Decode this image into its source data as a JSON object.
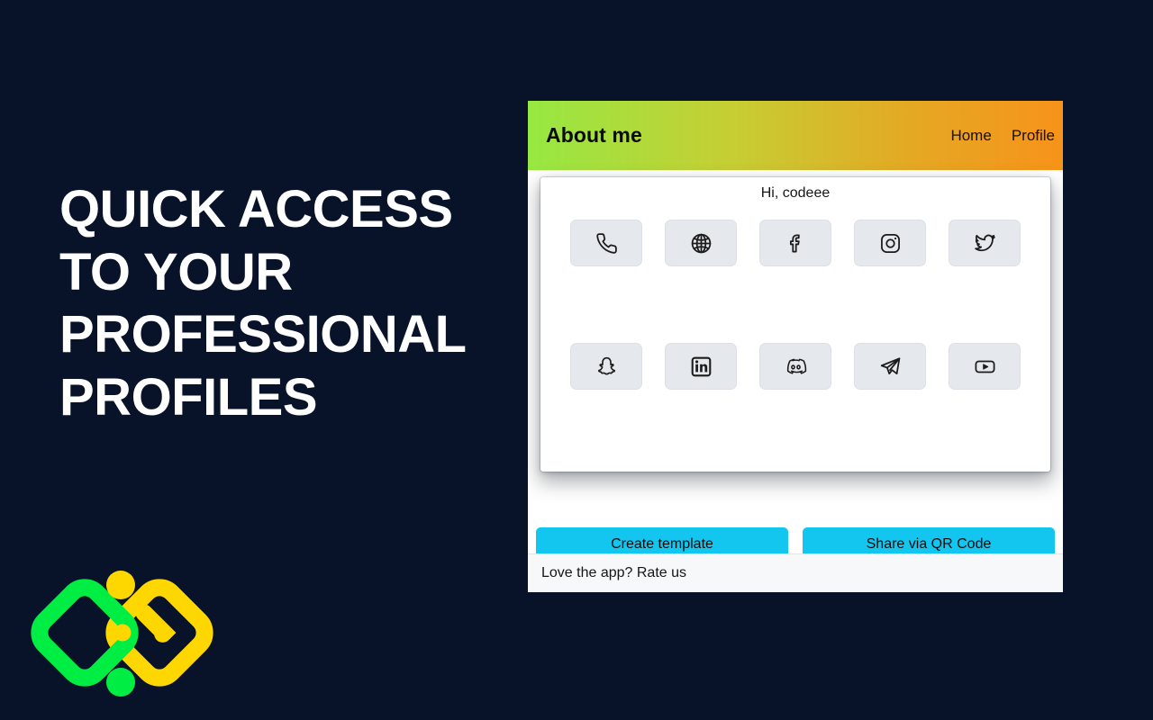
{
  "page": {
    "background_color": "#081228",
    "headline": "QUICK ACCESS TO YOUR PROFESSIONAL PROFILES"
  },
  "logo": {
    "name": "interlocking-diamonds-logo",
    "green_color": "#00EE44",
    "yellow_color": "#FFD700"
  },
  "app": {
    "header": {
      "title": "About me",
      "gradient_start": "#97E842",
      "gradient_end": "#F7931A",
      "nav": [
        {
          "label": "Home",
          "name": "nav-link-home"
        },
        {
          "label": "Profile",
          "name": "nav-link-profile"
        }
      ]
    },
    "card": {
      "greeting": "Hi, codeee",
      "icon_rows": [
        [
          {
            "name": "phone-icon",
            "label": "Phone"
          },
          {
            "name": "globe-icon",
            "label": "Website"
          },
          {
            "name": "facebook-icon",
            "label": "Facebook"
          },
          {
            "name": "instagram-icon",
            "label": "Instagram"
          },
          {
            "name": "twitter-icon",
            "label": "Twitter"
          }
        ],
        [
          {
            "name": "snapchat-icon",
            "label": "Snapchat"
          },
          {
            "name": "linkedin-icon",
            "label": "LinkedIn"
          },
          {
            "name": "discord-icon",
            "label": "Discord"
          },
          {
            "name": "telegram-icon",
            "label": "Telegram"
          },
          {
            "name": "youtube-icon",
            "label": "YouTube"
          }
        ]
      ],
      "tile_color": "#E5E8EC"
    },
    "actions": {
      "button_color": "#13C6EF",
      "create_template": "Create template",
      "share_qr": "Share via QR Code"
    },
    "footer": {
      "text": "Love the app? Rate us"
    }
  }
}
